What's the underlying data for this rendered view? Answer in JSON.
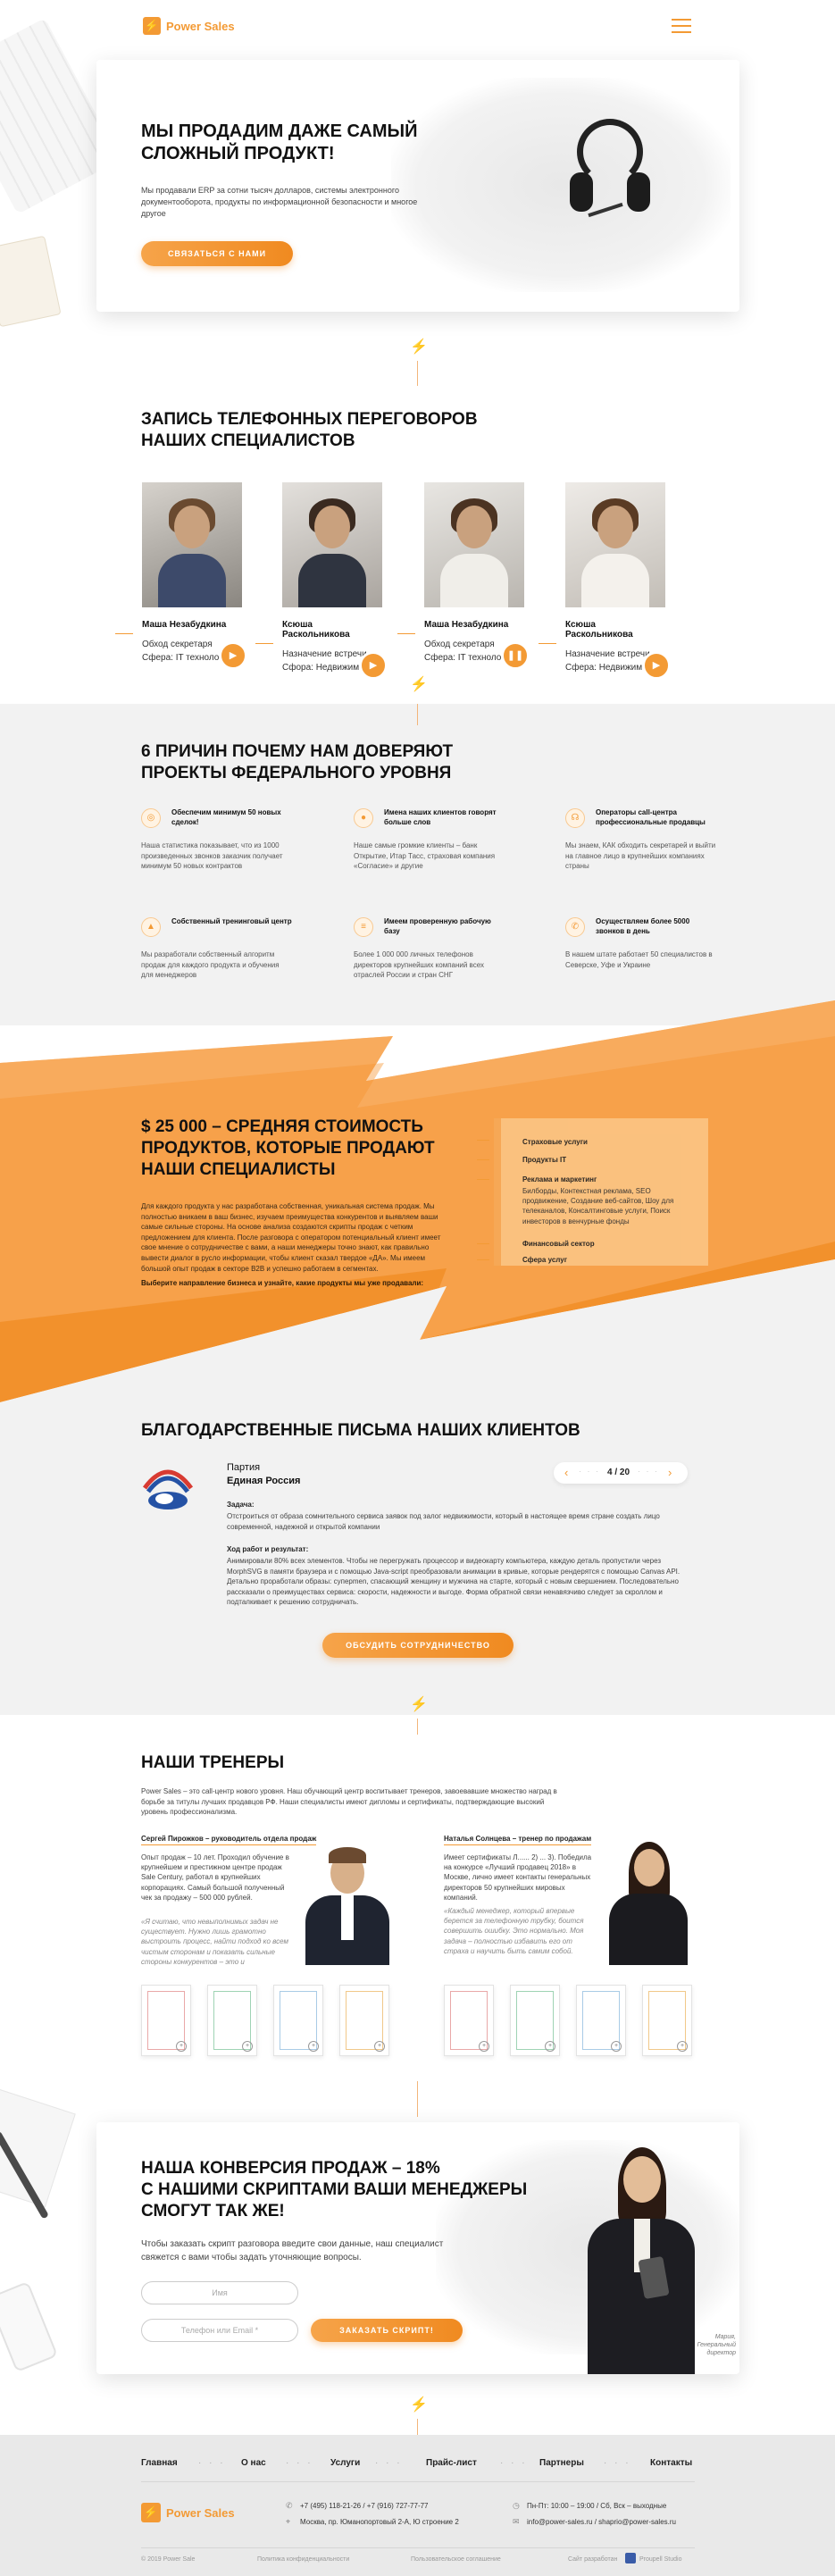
{
  "header": {
    "logo_text": "Power Sales",
    "menu_icon": "hamburger-icon"
  },
  "hero": {
    "title_line1": "МЫ ПРОДАДИМ ДАЖЕ САМЫЙ",
    "title_line2": "СЛОЖНЫЙ ПРОДУКТ!",
    "text": "Мы продавали ERP за сотни тысяч долларов, системы электронного документооборота, продукты по информационной безопасности и многое другое",
    "button": "СВЯЗАТЬСЯ С НАМИ"
  },
  "recordings": {
    "title_line1": "ЗАПИСЬ ТЕЛЕФОННЫХ ПЕРЕГОВОРОВ",
    "title_line2": "НАШИХ СПЕЦИАЛИСТОВ",
    "items": [
      {
        "name": "Маша Незабудкина",
        "task": "Обход секретаря",
        "sphere": "Сфера: IT технологии",
        "state": "play"
      },
      {
        "name": "Ксюша  Раскольникова",
        "task": "Назначение встречи",
        "sphere": "Сфора: Недвижимость",
        "state": "play"
      },
      {
        "name": "Маша Незабудкина",
        "task": "Обход секретаря",
        "sphere": "Сфера: IT технологии",
        "state": "pause"
      },
      {
        "name": "Ксюша  Раскольникова",
        "task": "Назначение встречи",
        "sphere": "Сфера: Недвижимость",
        "state": "play"
      }
    ]
  },
  "reasons": {
    "title_line1": "6 ПРИЧИН ПОЧЕМУ НАМ ДОВЕРЯЮТ",
    "title_line2": "ПРОЕКТЫ ФЕДЕРАЛЬНОГО УРОВНЯ",
    "items": [
      {
        "title": "Обеспечим минимум 50 новых сделок!",
        "text": "Наша статистика показывает, что из 1000 произведенных звонков заказчик получает минимум 50 новых контрактов",
        "icon": "target-icon"
      },
      {
        "title": "Имена наших клиентов говорят больше слов",
        "text": "Наше самые громкие клиенты – банк Открытие, Итар Тасс, страховая компания «Согласие» и другие",
        "icon": "person-icon"
      },
      {
        "title": "Операторы call-центра профессиональные продавцы",
        "text": "Мы знаем, КАК обходить секретарей и выйти на главное лицо в крупнейших компаниях страны",
        "icon": "headset-icon"
      },
      {
        "title": "Собственный тренинговый центр",
        "text": "Мы разработали собственный алгоритм продаж для каждого продукта и обучения для менеджеров",
        "icon": "graduation-icon"
      },
      {
        "title": "Имеем проверенную рабочую базу",
        "text": "Более 1 000 000 личных телефонов директоров крупнейших компаний всех отраслей России и стран СНГ",
        "icon": "database-icon"
      },
      {
        "title": "Осуществляем более 5000 звонков в день",
        "text": "В нашем штате работает 50 специалистов в Северске, Уфе и Украине",
        "icon": "phone-icon"
      }
    ]
  },
  "products": {
    "title_line1": "$ 25 000 – СРЕДНЯЯ СТОИМОСТЬ",
    "title_line2": "ПРОДУКТОВ, КОТОРЫЕ ПРОДАЮТ",
    "title_line3": "НАШИ СПЕЦИАЛИСТЫ",
    "text": "Для каждого продукта у нас разработана собственная, уникальная система продаж. Мы полностью вникаем в ваш бизнес, изучаем преимущества конкурентов и выявляем ваши самые сильные стороны. На основе анализа создаются скрипты продаж с четким предложением для клиента. После разговора с оператором потенциальный клиент имеет свое мнение о сотрудничестве с вами, а наши менеджеры точно знают, как правильно вывести диалог в русло информации, чтобы клиент сказал твердое «ДА». Мы имеем большой опыт продаж в секторе B2B и успешно работаем в сегментах.",
    "cta": "Выберите направление бизнеса и узнайте, какие продукты мы уже продавали:",
    "menu": [
      {
        "label": "Страховые услуги",
        "desc": ""
      },
      {
        "label": "Продукты IT",
        "desc": ""
      },
      {
        "label": "Реклама и маркетинг",
        "desc": "Билборды, Контекстная реклама, SEO продвижение, Создание веб-сайтов, Шоу для телеканалов, Консалтинговые услуги, Поиск инвесторов в венчурные фонды"
      },
      {
        "label": "Финансовый сектор",
        "desc": ""
      },
      {
        "label": "Сфера услуг",
        "desc": ""
      }
    ]
  },
  "letters": {
    "title": "БЛАГОДАРСТВЕННЫЕ ПИСЬМА НАШИХ КЛИЕНТОВ",
    "client_line1": "Партия",
    "client_line2": "Единая Россия",
    "pager": "4 / 20",
    "task_label": "Задача:",
    "task_text": "Отстроиться от образа сомнительного сервиса заявок под залог недвижимости, который в настоящее время стране создать лицо современной, надежной и открытой компании",
    "progress_label": "Ход работ и результат:",
    "progress_text": "Анимировали 80% всех элементов. Чтобы не перегружать процессор и видеокарту компьютера, каждую деталь пропустили через MorphSVG в памяти браузера и с помощью Java-script преобразовали анимации в кривые, которые рендерятся с помощью Canvas API. Детально проработали образы: суперmen, спасающий женщину и мужчина на старте, который с новым свершением. Последовательно рассказали о преимуществах сервиса: скорости, надежности и выгоде. Форма обратной связи ненавязчиво следует за скроллом и подталкивает к решению сотрудничать.",
    "button": "ОБСУДИТЬ СОТРУДНИЧЕСТВО"
  },
  "trainers": {
    "title": "НАШИ  ТРЕНЕРЫ",
    "intro": "Power Sales – это call-центр нового уровня. Наш обучающий центр воспитывает тренеров, завоевавшие множество наград в борьбе за титулы лучших продавцов РФ. Наши специалисты имеют дипломы и сертификаты, подтверждающие высокий уровень профессионализма.",
    "items": [
      {
        "name": "Сергей Пирожков – руководитель отдела продаж",
        "text": "Опыт продаж – 10 лет. Проходил обучение в крупнейшем и престижном центре продаж Sale Century, работал в крупнейших корпорациях. Самый большой полученный чек за продажу – 500 000 рублей.",
        "quote": "«Я считаю, что невыполнимых задач не существует. Нужно лишь грамотно выстроить процесс, найти подход ко всем чистым сторонам и показать сильные стороны конкурентов – это и"
      },
      {
        "name": "Наталья Солнцева – тренер по продажам",
        "text": "Имеет сертификаты Л...... 2) ... 3). Победила на конкурсе «Лучший продавец 2018» в Москве, лично имеет контакты генеральных директоров 50 крупнейших мировых компаний.",
        "quote": "«Каждый менеджер, который впервые берется за телефонную трубку, боится совершить ошибку. Это нормально. Моя задача – полностью избавить его от страха и научить быть самим собой."
      }
    ]
  },
  "conversion": {
    "title_line1": "НАША КОНВЕРСИЯ ПРОДАЖ – 18%",
    "title_line2": "С НАШИМИ СКРИПТАМИ ВАШИ МЕНЕДЖЕРЫ",
    "title_line3": "СМОГУТ ТАК ЖЕ!",
    "text": "Чтобы заказать скрипт разговора введите свои данные, наш специалист свяжется с вами чтобы задать уточняющие вопросы.",
    "name_placeholder": "Имя",
    "contact_placeholder": "Телефон или Email *",
    "button": "ЗАКАЗАТЬ СКРИПТ!",
    "caption": "Мария, Генеральный директор"
  },
  "footer": {
    "nav": [
      "Главная",
      "О нас",
      "Услуги",
      "Прайс-лист",
      "Партнеры",
      "Контакты"
    ],
    "logo_text": "Power Sales",
    "phones": "+7 (495) 118-21-26   /   +7 (916) 727-77-77",
    "address": "Москва, пр. Юманопортовый 2-А, Ю строение 2",
    "hours": "Пн-Пт: 10:00 – 19:00   /   Сб, Вск – выходные",
    "emails": "info@power-sales.ru   /   shaprio@power-sales.ru",
    "copyright": "© 2019 Power Sale",
    "privacy": "Политика конфиденциальности",
    "agreement": "Пользовательское соглашение",
    "developer": "Сайт разработан",
    "studio": "Proupell Studio"
  },
  "colors": {
    "accent": "#f39a34",
    "light_bg": "#f2f2f2",
    "footer_bg": "#e9e9e9"
  }
}
